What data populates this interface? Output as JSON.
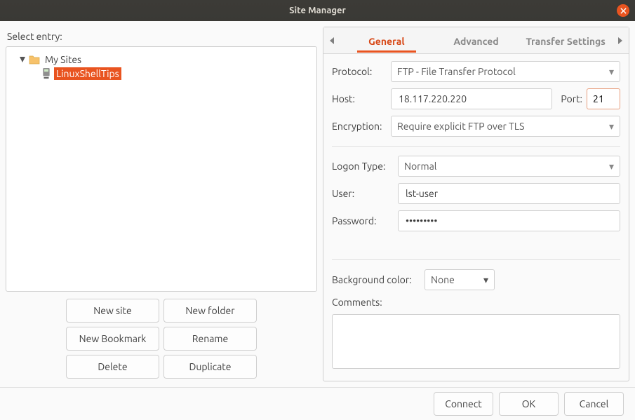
{
  "title": "Site Manager",
  "left": {
    "select_label": "Select entry:",
    "folder": "My Sites",
    "site": "LinuxShellTips",
    "buttons": {
      "new_site": "New site",
      "new_folder": "New folder",
      "new_bookmark": "New Bookmark",
      "rename": "Rename",
      "delete": "Delete",
      "duplicate": "Duplicate"
    }
  },
  "tabs": {
    "general": "General",
    "advanced": "Advanced",
    "transfer": "Transfer Settings"
  },
  "form": {
    "protocol_label": "Protocol:",
    "protocol_value": "FTP - File Transfer Protocol",
    "host_label": "Host:",
    "host_value": "18.117.220.220",
    "port_label": "Port:",
    "port_value": "21",
    "encryption_label": "Encryption:",
    "encryption_value": "Require explicit FTP over TLS",
    "logon_label": "Logon Type:",
    "logon_value": "Normal",
    "user_label": "User:",
    "user_value": "lst-user",
    "password_label": "Password:",
    "password_value": "•••••••••",
    "bgcolor_label": "Background color:",
    "bgcolor_value": "None",
    "comments_label": "Comments:"
  },
  "footer": {
    "connect": "Connect",
    "ok": "OK",
    "cancel": "Cancel"
  }
}
